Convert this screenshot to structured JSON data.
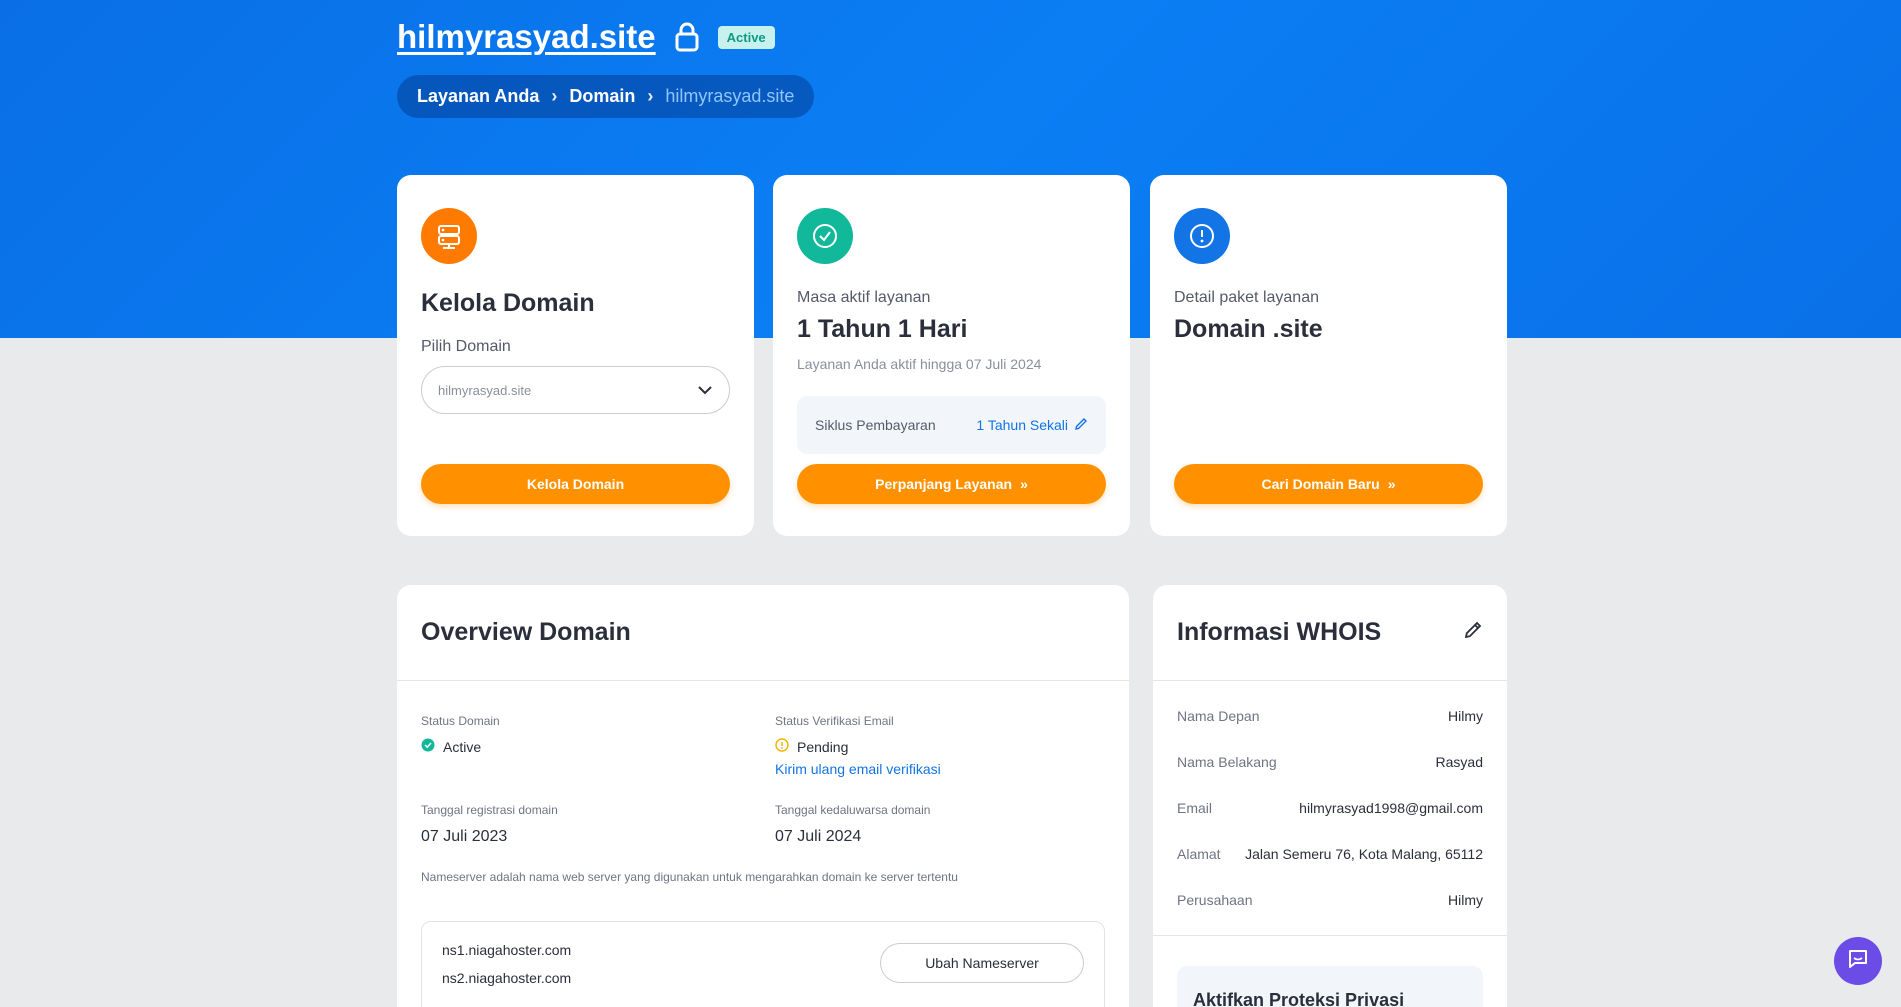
{
  "header": {
    "site_title": "hilmyrasyad.site",
    "status_badge": "Active",
    "breadcrumb": [
      "Layanan Anda",
      "Domain",
      "hilmyrasyad.site"
    ]
  },
  "cards": {
    "manage": {
      "title": "Kelola Domain",
      "select_label": "Pilih Domain",
      "select_value": "hilmyrasyad.site",
      "button": "Kelola Domain"
    },
    "active_period": {
      "label": "Masa aktif layanan",
      "value": "1 Tahun 1 Hari",
      "note": "Layanan Anda aktif hingga 07 Juli 2024",
      "cycle_label": "Siklus Pembayaran",
      "cycle_value": "1 Tahun Sekali",
      "button": "Perpanjang Layanan"
    },
    "package": {
      "label": "Detail paket layanan",
      "value": "Domain .site",
      "button": "Cari Domain Baru"
    }
  },
  "overview": {
    "title": "Overview Domain",
    "status_label": "Status Domain",
    "status_value": "Active",
    "email_label": "Status Verifikasi Email",
    "email_value": "Pending",
    "resend_link": "Kirim ulang email verifikasi",
    "reg_label": "Tanggal registrasi domain",
    "reg_value": "07 Juli 2023",
    "exp_label": "Tanggal kedaluwarsa domain",
    "exp_value": "07 Juli 2024",
    "ns_note": "Nameserver adalah nama web server yang digunakan untuk mengarahkan domain ke server tertentu",
    "nameservers": [
      "ns1.niagahoster.com",
      "ns2.niagahoster.com"
    ],
    "ns_button": "Ubah Nameserver"
  },
  "whois": {
    "title": "Informasi WHOIS",
    "rows": [
      {
        "label": "Nama Depan",
        "value": "Hilmy"
      },
      {
        "label": "Nama Belakang",
        "value": "Rasyad"
      },
      {
        "label": "Email",
        "value": "hilmyrasyad1998@gmail.com"
      },
      {
        "label": "Alamat",
        "value": "Jalan Semeru 76, Kota Malang, 65112"
      },
      {
        "label": "Perusahaan",
        "value": "Hilmy"
      }
    ],
    "privacy_title": "Aktifkan Proteksi Privasi"
  },
  "colors": {
    "hero_blue": "#0b7ef4",
    "accent_orange": "#ff9100",
    "success_green": "#12b89a",
    "info_blue": "#1274e5",
    "chat_purple": "#6b4ce6"
  }
}
